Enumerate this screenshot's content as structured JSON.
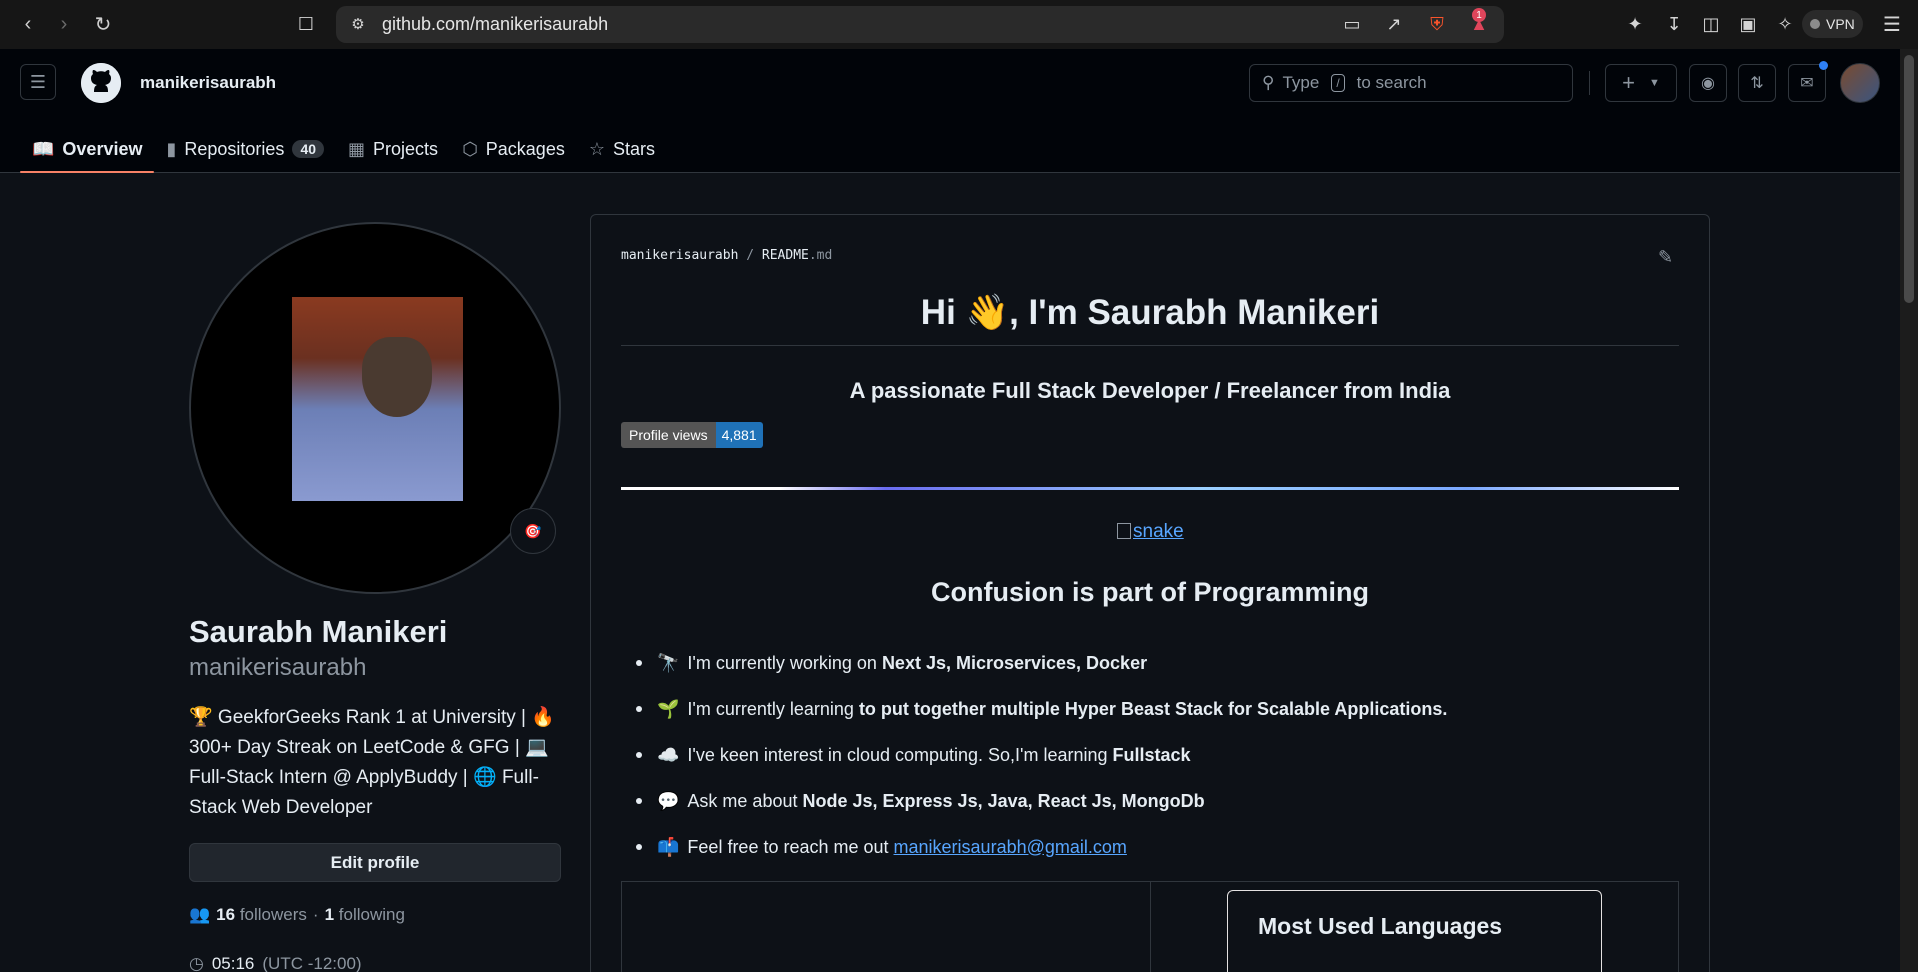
{
  "browser": {
    "url": "github.com/manikerisaurabh",
    "vpn_label": "VPN",
    "alert_badge": "1"
  },
  "header": {
    "username": "manikerisaurabh",
    "search_prefix": "Type",
    "search_key": "/",
    "search_suffix": "to search"
  },
  "tabs": [
    {
      "label": "Overview",
      "icon": "book-icon"
    },
    {
      "label": "Repositories",
      "icon": "repo-icon",
      "count": "40"
    },
    {
      "label": "Projects",
      "icon": "table-icon"
    },
    {
      "label": "Packages",
      "icon": "package-icon"
    },
    {
      "label": "Stars",
      "icon": "star-icon"
    }
  ],
  "profile": {
    "name": "Saurabh Manikeri",
    "login": "manikerisaurabh",
    "bio": "🏆 GeekforGeeks Rank 1 at University | 🔥 300+ Day Streak on LeetCode & GFG | 💻 Full-Stack Intern @ ApplyBuddy | 🌐 Full-Stack Web Developer",
    "edit_label": "Edit profile",
    "followers_count": "16",
    "followers_label": "followers",
    "separator": "·",
    "following_count": "1",
    "following_label": "following",
    "local_time": "05:16",
    "timezone": "(UTC -12:00)"
  },
  "readme": {
    "path_owner": "manikerisaurabh",
    "path_sep": "/",
    "path_file": "README",
    "path_ext": ".md",
    "title": "Hi 👋, I'm Saurabh Manikeri",
    "subtitle": "A passionate Full Stack Developer / Freelancer from India",
    "badge_label": "Profile views",
    "badge_value": "4,881",
    "snake_alt": "snake",
    "section_title": "Confusion is part of Programming",
    "items": [
      {
        "emoji": "🔭",
        "text": "I'm currently working on ",
        "bold": "Next Js, Microservices, Docker"
      },
      {
        "emoji": "🌱",
        "text": "I'm currently learning ",
        "bold": "to put together multiple Hyper Beast Stack for Scalable Applications."
      },
      {
        "emoji": "☁️",
        "text": "I've keen interest in cloud computing. So,I'm learning ",
        "bold": "Fullstack"
      },
      {
        "emoji": "💬",
        "text": "Ask me about ",
        "bold": "Node Js, Express Js, Java, React Js, MongoDb"
      },
      {
        "emoji": "📫",
        "text": "Feel free to reach me out ",
        "link": "manikerisaurabh@gmail.com"
      }
    ],
    "lang_card_title": "Most Used Languages"
  },
  "colors": {
    "accent_tab": "#f78166",
    "link": "#58a6ff",
    "badge_value_bg": "#1f72b8"
  }
}
